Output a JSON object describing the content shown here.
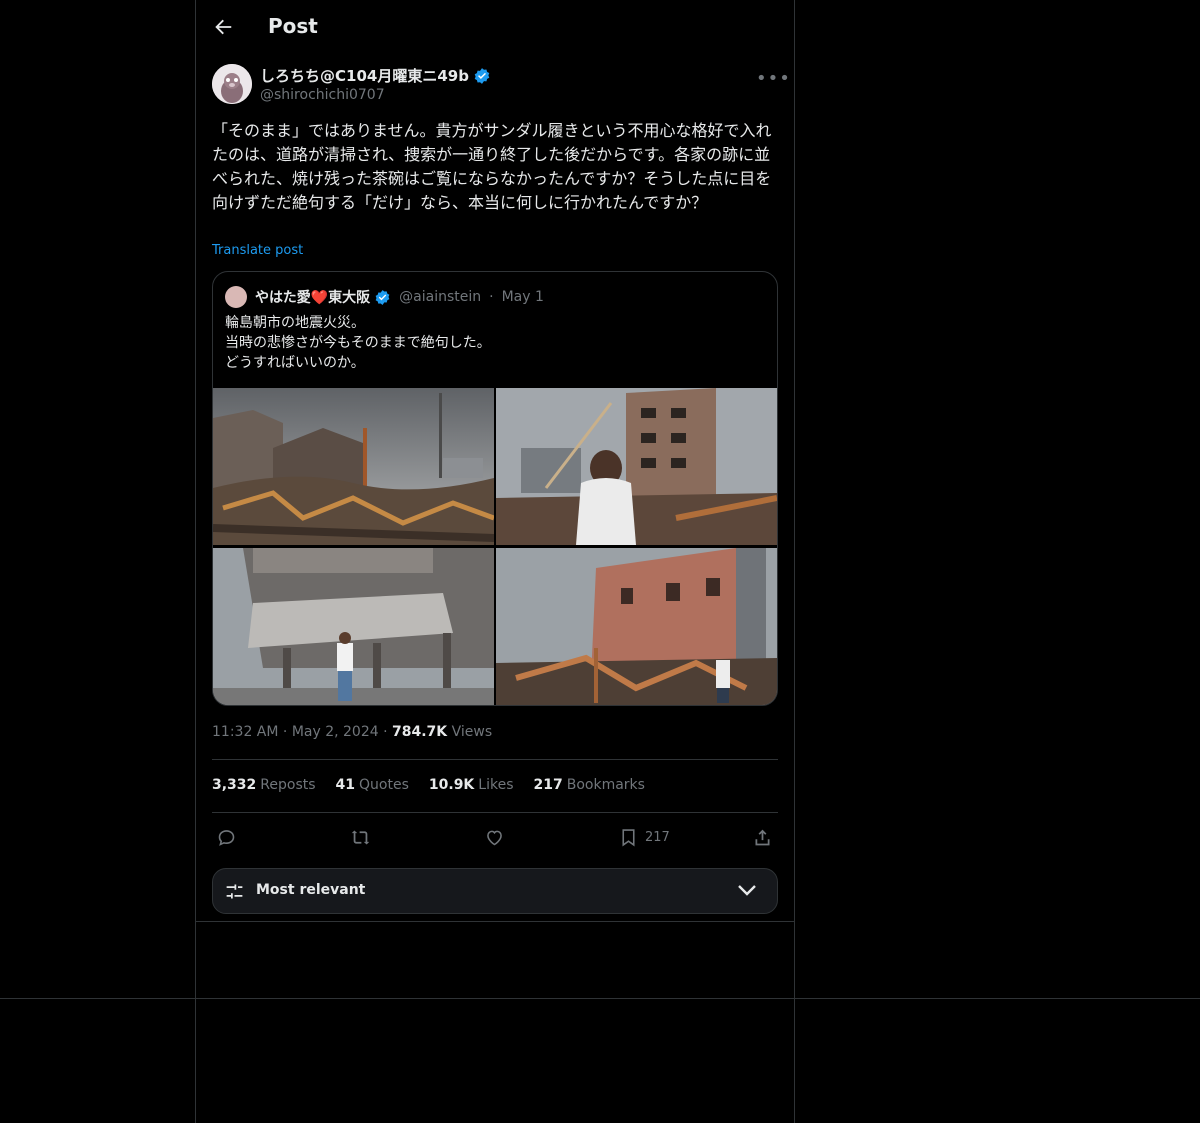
{
  "header": {
    "title": "Post"
  },
  "post": {
    "author_name": "しろちち@C104月曜東ニ49b",
    "author_handle": "@shirochichi0707",
    "text": "「そのまま」ではありません。貴方がサンダル履きという不用心な格好で入れたのは、道路が清掃され、捜索が一通り終了した後だからです。各家の跡に並べられた、焼け残った茶碗はご覧にならなかったんですか？そうした点に目を向けずただ絶句する「だけ」なら、本当に何しに行かれたんですか？",
    "translate_label": "Translate post",
    "time": "11:32 AM",
    "date": "May 2, 2024",
    "views_count": "784.7K",
    "views_label": "Views",
    "sep": "·"
  },
  "quoted": {
    "name": "やはた愛❤️東大阪",
    "handle": "@aiainstein",
    "sep": "·",
    "date": "May 1",
    "text": "輪島朝市の地震火災。\n当時の悲惨さが今もそのままで絶句した。\nどうすればいいのか。"
  },
  "stats": {
    "reposts_count": "3,332",
    "reposts_label": "Reposts",
    "quotes_count": "41",
    "quotes_label": "Quotes",
    "likes_count": "10.9K",
    "likes_label": "Likes",
    "bookmarks_count": "217",
    "bookmarks_label": "Bookmarks"
  },
  "actions": {
    "bookmark_count": "217"
  },
  "sort": {
    "label": "Most relevant"
  },
  "icons": [
    "back-arrow-icon",
    "verified-badge-icon",
    "more-icon",
    "reply-icon",
    "repost-icon",
    "like-icon",
    "bookmark-icon",
    "share-icon",
    "sliders-icon",
    "chevron-down-icon"
  ],
  "colors": {
    "background": "#000000",
    "text": "#e7e9ea",
    "muted": "#71767b",
    "link": "#1d9bf0",
    "border": "#2f3336",
    "verified": "#1d9bf0",
    "heart": "#e0245e"
  }
}
